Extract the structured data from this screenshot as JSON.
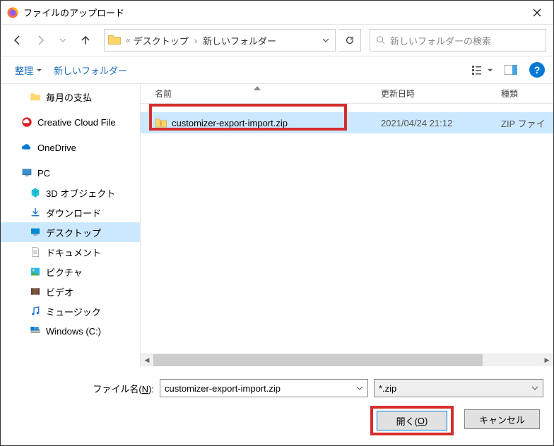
{
  "window_title": "ファイルのアップロード",
  "breadcrumb": {
    "seg1": "デスクトップ",
    "seg2": "新しいフォルダー"
  },
  "search_placeholder": "新しいフォルダーの検索",
  "toolbar": {
    "organize": "整理",
    "new_folder": "新しいフォルダー"
  },
  "columns": {
    "name": "名前",
    "date": "更新日時",
    "type": "種類"
  },
  "sidebar": {
    "monthly_pay": "毎月の支払",
    "ccf": "Creative Cloud File",
    "onedrive": "OneDrive",
    "pc": "PC",
    "objects3d": "3D オブジェクト",
    "downloads": "ダウンロード",
    "desktop": "デスクトップ",
    "documents": "ドキュメント",
    "pictures": "ピクチャ",
    "videos": "ビデオ",
    "music": "ミュージック",
    "windows_c": "Windows (C:)"
  },
  "file": {
    "name": "customizer-export-import.zip",
    "date": "2021/04/24 21:12",
    "type": "ZIP ファイ"
  },
  "footer": {
    "filename_label_pre": "ファイル名(",
    "filename_label_key": "N",
    "filename_label_post": "):",
    "filename_value": "customizer-export-import.zip",
    "filter": "*.zip",
    "open_pre": "開く(",
    "open_key": "O",
    "open_post": ")",
    "cancel": "キャンセル"
  }
}
